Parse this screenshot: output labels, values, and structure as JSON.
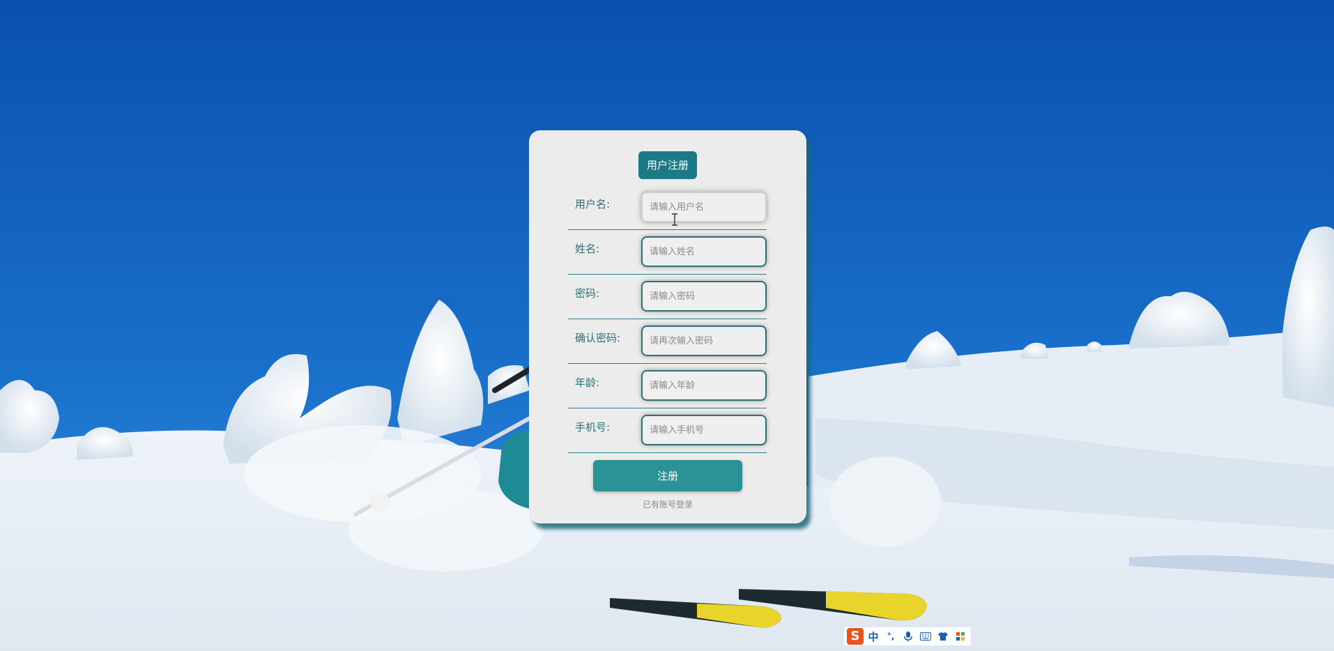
{
  "form": {
    "title": "用户注册",
    "fields": [
      {
        "label": "用户名:",
        "placeholder": "请输入用户名"
      },
      {
        "label": "姓名:",
        "placeholder": "请输入姓名"
      },
      {
        "label": "密码:",
        "placeholder": "请输入密码"
      },
      {
        "label": "确认密码:",
        "placeholder": "请再次输入密码"
      },
      {
        "label": "年龄:",
        "placeholder": "请输入年龄"
      },
      {
        "label": "手机号:",
        "placeholder": "请输入手机号"
      }
    ],
    "submit_label": "注册",
    "login_link": "已有账号登录"
  },
  "ime_toolbar": {
    "mode_label": "中",
    "punctuation_label": "°,",
    "icons": [
      "sogou-logo-icon",
      "voice-mic-icon",
      "keyboard-icon",
      "skin-shirt-icon",
      "toolbox-icon"
    ]
  },
  "colors": {
    "sky_top": "#0b56b3",
    "sky_bottom": "#2a85d6",
    "card_bg": "#ececec",
    "accent": "#1c7a87",
    "button": "#2b9397",
    "label_text": "#2a7078"
  }
}
